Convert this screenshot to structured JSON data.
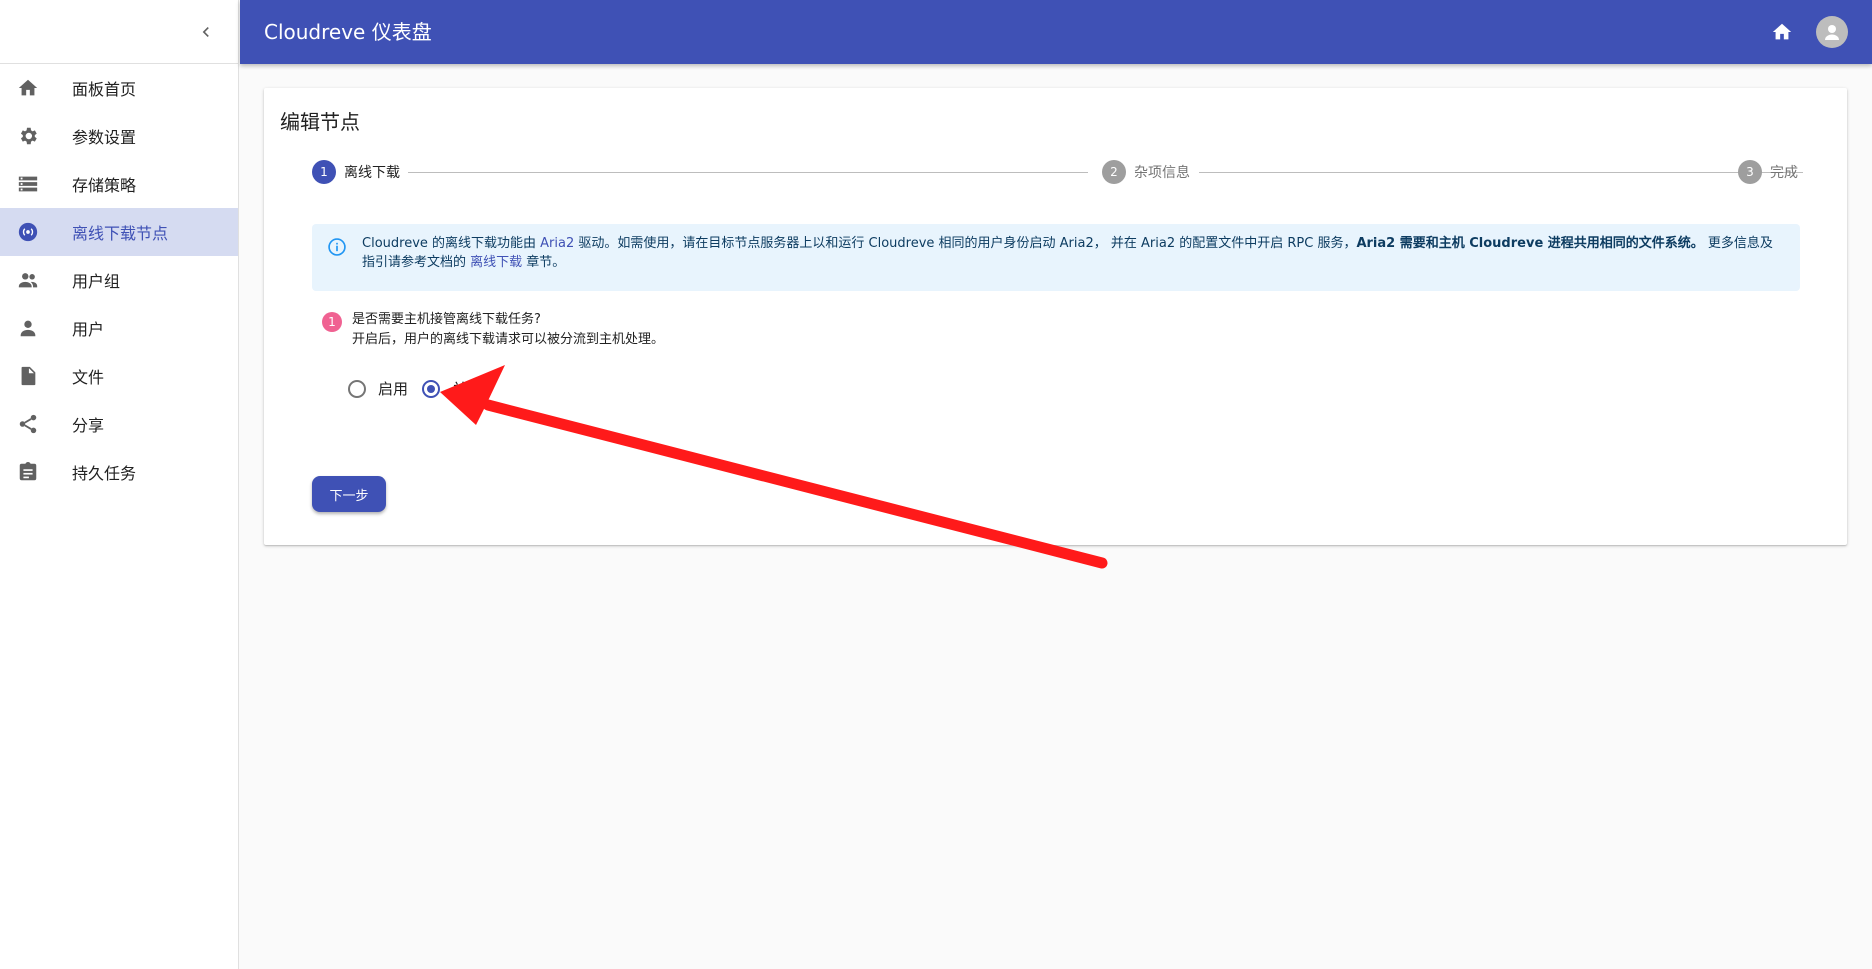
{
  "sidebar": {
    "items": [
      {
        "label": "面板首页",
        "icon": "home-icon",
        "active": false
      },
      {
        "label": "参数设置",
        "icon": "gear-icon",
        "active": false
      },
      {
        "label": "存储策略",
        "icon": "storage-icon",
        "active": false
      },
      {
        "label": "离线下载节点",
        "icon": "download-node-icon",
        "active": true
      },
      {
        "label": "用户组",
        "icon": "group-icon",
        "active": false
      },
      {
        "label": "用户",
        "icon": "person-icon",
        "active": false
      },
      {
        "label": "文件",
        "icon": "file-icon",
        "active": false
      },
      {
        "label": "分享",
        "icon": "share-icon",
        "active": false
      },
      {
        "label": "持久任务",
        "icon": "task-icon",
        "active": false
      }
    ]
  },
  "header": {
    "title": "Cloudreve 仪表盘",
    "accent_color": "#3f51b5"
  },
  "card": {
    "title": "编辑节点",
    "steps": [
      {
        "num": "1",
        "label": "离线下载",
        "active": true
      },
      {
        "num": "2",
        "label": "杂项信息",
        "active": false
      },
      {
        "num": "3",
        "label": "完成",
        "active": false
      }
    ],
    "alert": {
      "p1": "Cloudreve 的离线下载功能由 ",
      "link1": "Aria2",
      "p2": " 驱动。如需使用，请在目标节点服务器上以和运行 Cloudreve 相同的用户身份启动 Aria2， 并在 Aria2 的配置文件中开启 RPC 服务，",
      "bold": "Aria2 需要和主机 Cloudreve 进程共用相同的文件系统。",
      "p3": " 更多信息及指引请参考文档的 ",
      "link2": "离线下载",
      "p4": " 章节。"
    },
    "question": {
      "badge": "1",
      "line1": "是否需要主机接管离线下载任务?",
      "line2": "开启后，用户的离线下载请求可以被分流到主机处理。"
    },
    "radio": {
      "enable_label": "启用",
      "disable_label": "关闭",
      "selected": "disable"
    },
    "next_label": "下一步"
  },
  "annotation": {
    "arrow_color": "#ff1a1a"
  }
}
